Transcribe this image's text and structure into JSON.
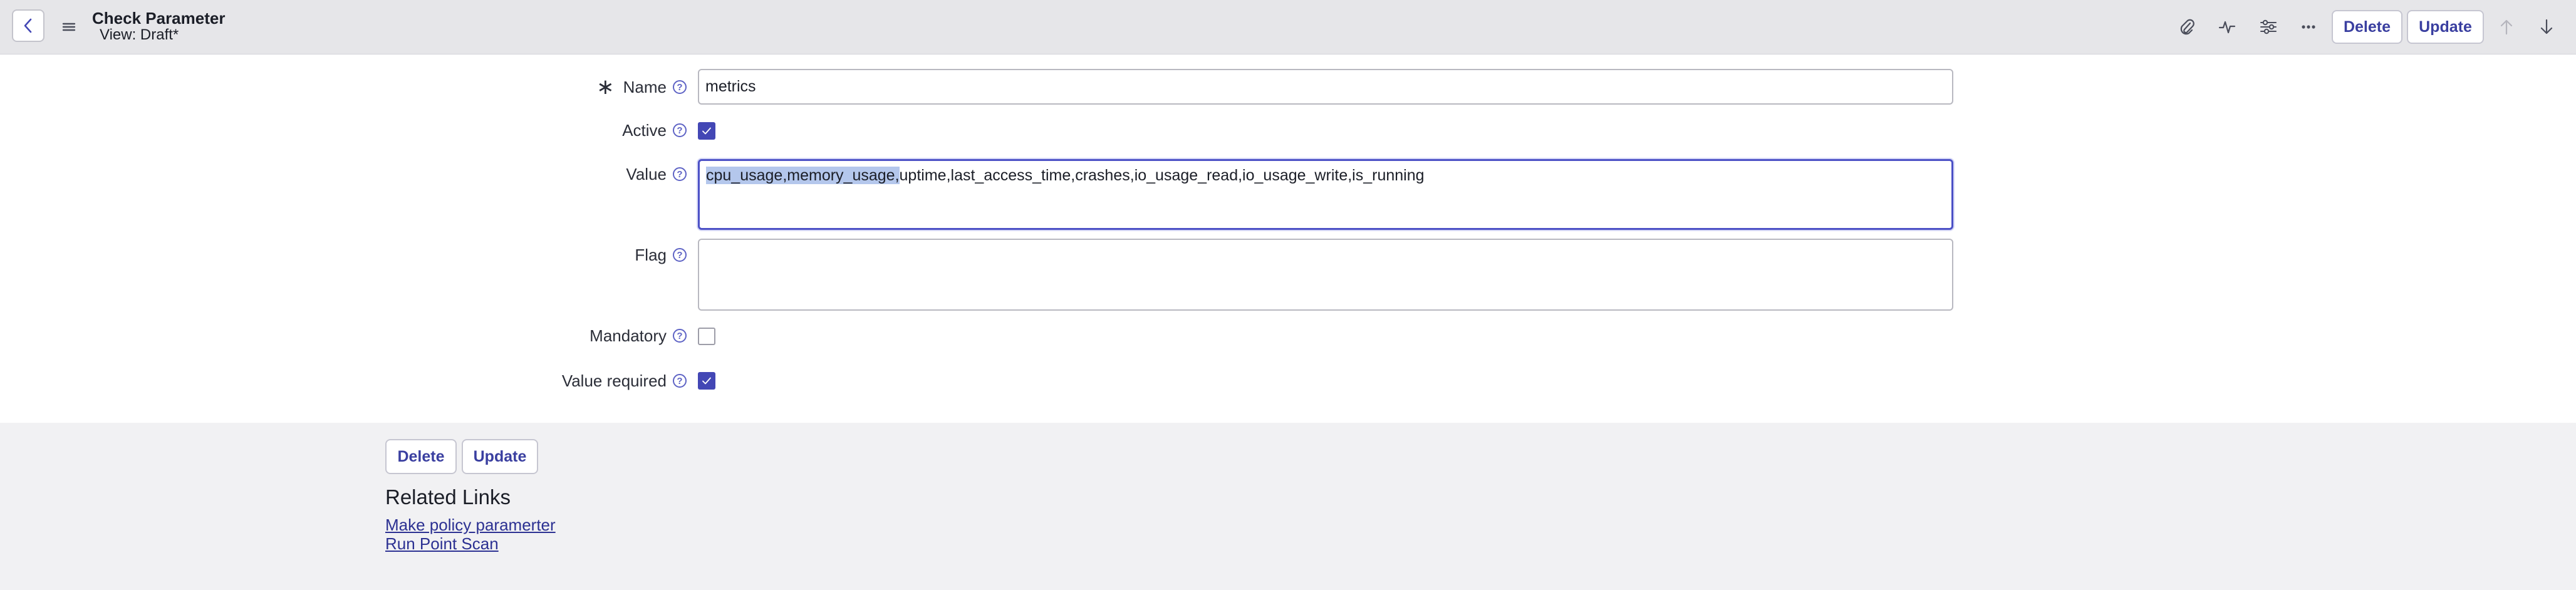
{
  "header": {
    "title": "Check Parameter",
    "subtitle": "View: Draft*",
    "delete_label": "Delete",
    "update_label": "Update"
  },
  "form": {
    "name": {
      "label": "Name",
      "value": "metrics"
    },
    "active": {
      "label": "Active",
      "checked": true
    },
    "value": {
      "label": "Value",
      "selected_text": "cpu_usage,memory_usage,",
      "rest_text": "uptime,last_access_time,crashes,io_usage_read,io_usage_write,is_running"
    },
    "flag": {
      "label": "Flag",
      "value": ""
    },
    "mandatory": {
      "label": "Mandatory",
      "checked": false
    },
    "value_required": {
      "label": "Value required",
      "checked": true
    }
  },
  "footer": {
    "delete_label": "Delete",
    "update_label": "Update",
    "related_title": "Related Links",
    "links": [
      "Make policy paramerter",
      "Run Point Scan"
    ]
  },
  "colors": {
    "accent": "#4347b5",
    "link": "#2c3192",
    "selection": "#b4c7ec"
  }
}
